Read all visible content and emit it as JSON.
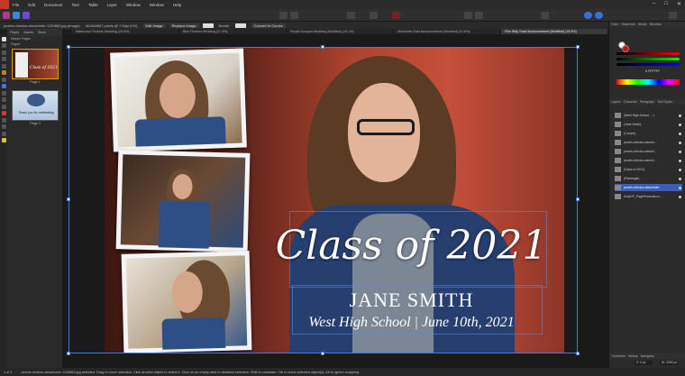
{
  "menubar": {
    "items": [
      "File",
      "Edit",
      "Document",
      "Text",
      "Table",
      "Layer",
      "Window",
      "Window",
      "Help"
    ]
  },
  "context": {
    "file_label": "pexels-vinicius-wiesehofer-1130862.jpg (Image)",
    "size_label": "4016x5857 pixels @ 7.5dpi (0%)",
    "edit_image": "Edit Image",
    "replace_image": "Replace Image",
    "border_label": "Border",
    "convert_button": "Convert to Curves"
  },
  "tabs": [
    {
      "label": "Watercolor Flowers Wedding (20.8%)"
    },
    {
      "label": "Blue Flowers Wedding (21.3%)"
    },
    {
      "label": "Purple Bouquet Wedding (Modified) (15.1%)"
    },
    {
      "label": "Silhouette Grad Announcement (Modified) (21.6%)"
    },
    {
      "label": "Film Strip Grad Announcement (Modified) (19.5%)"
    }
  ],
  "pages_panel": {
    "tabs": [
      "Pages",
      "Assets",
      "Stock"
    ],
    "master_label": "Master Pages",
    "pages_label": "Pages",
    "page1_caption": "Page 1",
    "page2_caption": "Page 2",
    "thumb1_text": "Class of 2021",
    "thumb2_text": "Thank you for celebrating"
  },
  "canvas": {
    "title": "Class of 2021",
    "name": "JANE SMITH",
    "subtitle": "West High School   |   June 10th, 2021"
  },
  "right_panel": {
    "tabs": [
      "Color",
      "Swatches",
      "Stroke",
      "Brushes"
    ],
    "hex_value": "# FFFFFF",
    "layer_tabs": [
      "Layers",
      "Character",
      "Paragraph",
      "Text Styles"
    ],
    "layers": [
      {
        "name": "(West High School ... )"
      },
      {
        "name": "(Jane Smith)"
      },
      {
        "name": "(Curves)"
      },
      {
        "name": "pexels-vinicius-wieseh..."
      },
      {
        "name": "pexels-vinicius-wieseh..."
      },
      {
        "name": "pexels-vinicius-wieseh..."
      },
      {
        "name": "(Class of 2021)"
      },
      {
        "name": "(Rectangle)"
      },
      {
        "name": "pexels-vinicius-wiesehofer"
      },
      {
        "name": "AndyVF_PageProductions..."
      }
    ],
    "selected_layer_index": 8,
    "transform_tabs": [
      "Transform",
      "History",
      "Navigator"
    ],
    "transform_fields": [
      "X: 0 px",
      "Y: 0 px",
      "W: 3300 px",
      "H: 2550 px",
      "R: 0°",
      "S: 0°"
    ]
  },
  "status": {
    "page_indicator": "1 of 2",
    "message": "pexels-vinicius-wiesehofer-1130862.jpg selected. Drag to move selection. Click another object to select it. Click on an empty area to deselect selection. Shift to constrain. Ctrl to clone selected object(s). Alt to ignore snapping."
  },
  "colors": {
    "accent": "#3a5fb5",
    "selection_border": "#4a7ad8",
    "brand": "#c0392b"
  }
}
